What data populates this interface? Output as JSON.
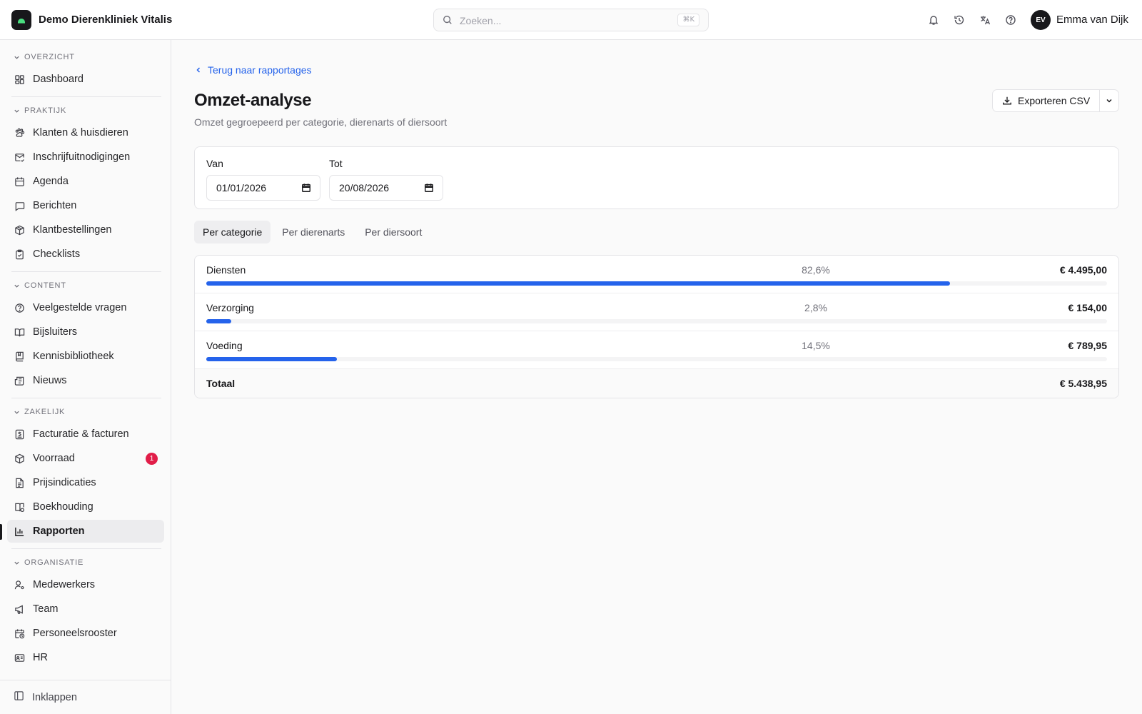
{
  "header": {
    "brand": "Demo Dierenkliniek Vitalis",
    "search_placeholder": "Zoeken...",
    "search_shortcut": "⌘K",
    "user_initials": "EV",
    "user_name": "Emma van Dijk"
  },
  "sidebar": {
    "sections": {
      "overzicht": "OVERZICHT",
      "praktijk": "PRAKTIJK",
      "content": "CONTENT",
      "zakelijk": "ZAKELIJK",
      "organisatie": "ORGANISATIE"
    },
    "items": {
      "dashboard": "Dashboard",
      "klanten": "Klanten & huisdieren",
      "inschrijf": "Inschrijfuitnodigingen",
      "agenda": "Agenda",
      "berichten": "Berichten",
      "bestellingen": "Klantbestellingen",
      "checklists": "Checklists",
      "faq": "Veelgestelde vragen",
      "bijsluiters": "Bijsluiters",
      "kennis": "Kennisbibliotheek",
      "nieuws": "Nieuws",
      "facturatie": "Facturatie & facturen",
      "voorraad": "Voorraad",
      "prijs": "Prijsindicaties",
      "boekhouding": "Boekhouding",
      "rapporten": "Rapporten",
      "medewerkers": "Medewerkers",
      "team": "Team",
      "rooster": "Personeelsrooster",
      "hr": "HR"
    },
    "voorraad_badge": "1",
    "collapse_label": "Inklappen"
  },
  "page": {
    "back_link": "Terug naar rapportages",
    "title": "Omzet-analyse",
    "subtitle": "Omzet gegroepeerd per categorie, dierenarts of diersoort",
    "export_label": "Exporteren CSV"
  },
  "filters": {
    "from_label": "Van",
    "from_value": "01/01/2026",
    "to_label": "Tot",
    "to_value": "20/08/2026"
  },
  "tabs": [
    "Per categorie",
    "Per dierenarts",
    "Per diersoort"
  ],
  "active_tab": 0,
  "rows": [
    {
      "name": "Diensten",
      "pct": "82,6%",
      "amount": "€ 4.495,00",
      "share": 0.826
    },
    {
      "name": "Verzorging",
      "pct": "2,8%",
      "amount": "€ 154,00",
      "share": 0.028
    },
    {
      "name": "Voeding",
      "pct": "14,5%",
      "amount": "€ 789,95",
      "share": 0.145
    }
  ],
  "total": {
    "label": "Totaal",
    "amount": "€ 5.438,95"
  },
  "colors": {
    "accent": "#2563eb",
    "badge": "#e11d48",
    "dark": "#18181b"
  }
}
